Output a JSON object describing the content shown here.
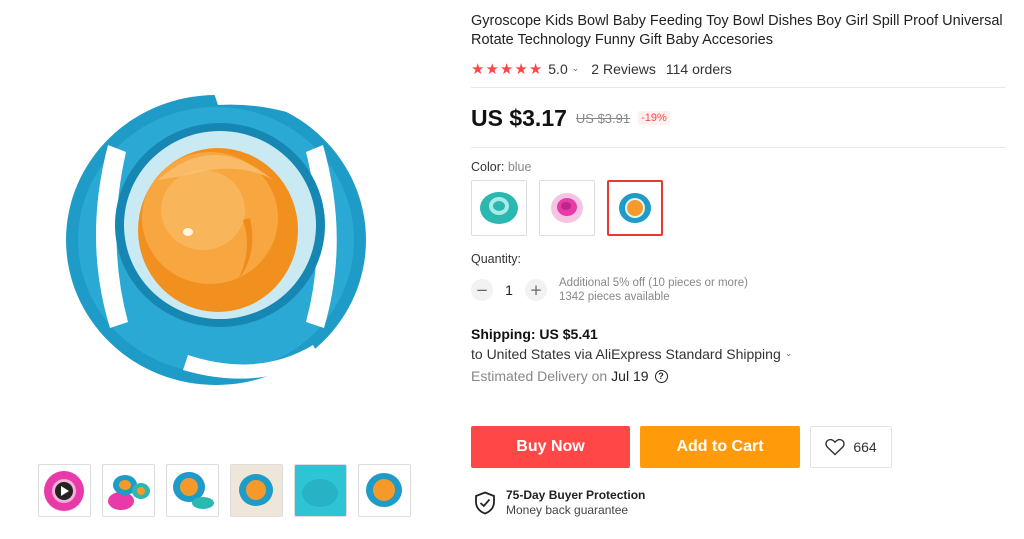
{
  "product": {
    "title": "Gyroscope Kids Bowl Baby Feeding Toy Bowl Dishes Boy Girl Spill Proof Universal Rotate Technology Funny Gift Baby Accesories",
    "rating": "5.0",
    "rating_stars": 5,
    "reviews": "2 Reviews",
    "orders": "114 orders"
  },
  "price": {
    "current": "US $3.17",
    "original": "US $3.91",
    "discount": "-19%"
  },
  "color": {
    "label": "Color:",
    "selected": "blue",
    "options": [
      "teal",
      "pink",
      "blue"
    ]
  },
  "quantity": {
    "label": "Quantity:",
    "value": "1",
    "minus": "−",
    "plus": "+",
    "note_line1": "Additional 5% off (10 pieces or more)",
    "note_line2": "1342 pieces available"
  },
  "shipping": {
    "title": "Shipping: US $5.41",
    "line": "to United States via AliExpress Standard Shipping",
    "delivery_prefix": "Estimated Delivery on",
    "delivery_date": "Jul 19"
  },
  "actions": {
    "buy_now": "Buy Now",
    "add_to_cart": "Add to Cart",
    "wishlist_count": "664"
  },
  "protection": {
    "title": "75-Day Buyer Protection",
    "subtitle": "Money back guarantee"
  },
  "icons": {
    "star": "★",
    "chevron": "⌄",
    "heart": "heart-icon",
    "shield": "shield-check-icon",
    "help": "?"
  },
  "colors": {
    "accent_red": "#ff4747",
    "accent_orange": "#ff9a0a",
    "bowl_blue": "#1e9bc6",
    "bowl_orange": "#f59a2a",
    "bowl_pink": "#e83aa8",
    "bowl_teal": "#2bb8b0"
  }
}
